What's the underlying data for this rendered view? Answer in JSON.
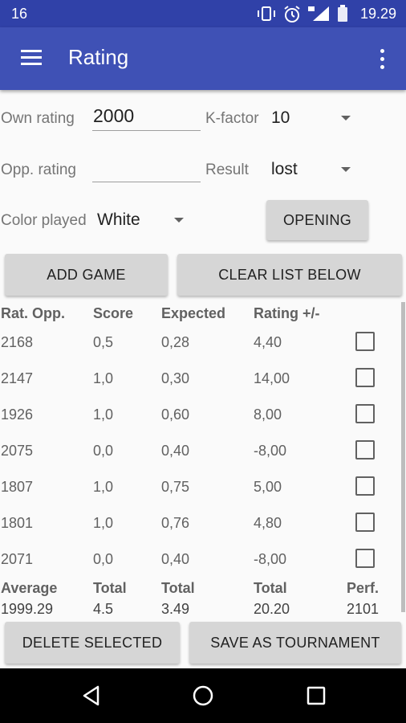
{
  "status_bar": {
    "left_time": "16",
    "time": "19.29"
  },
  "app_bar": {
    "title": "Rating"
  },
  "form": {
    "own_rating_label": "Own rating",
    "own_rating_value": "2000",
    "kfactor_label": "K-factor",
    "kfactor_value": "10",
    "opp_rating_label": "Opp. rating",
    "opp_rating_value": "",
    "result_label": "Result",
    "result_value": "lost",
    "color_label": "Color played",
    "color_value": "White",
    "opening_button": "OPENING"
  },
  "actions": {
    "add_game": "ADD GAME",
    "clear_list": "CLEAR LIST BELOW"
  },
  "table": {
    "headers": [
      "Rat. Opp.",
      "Score",
      "Expected",
      "Rating +/-"
    ],
    "rows": [
      [
        "2168",
        "0,5",
        "0,28",
        "4,40"
      ],
      [
        "2147",
        "1,0",
        "0,30",
        "14,00"
      ],
      [
        "1926",
        "1,0",
        "0,60",
        "8,00"
      ],
      [
        "2075",
        "0,0",
        "0,40",
        "-8,00"
      ],
      [
        "1807",
        "1,0",
        "0,75",
        "5,00"
      ],
      [
        "1801",
        "1,0",
        "0,76",
        "4,80"
      ],
      [
        "2071",
        "0,0",
        "0,40",
        "-8,00"
      ]
    ],
    "footer_labels": [
      "Average",
      "Total",
      "Total",
      "Total",
      "Perf."
    ],
    "footer_values": [
      "1999.29",
      "4.5",
      "3.49",
      "20.20",
      "2101"
    ]
  },
  "bottom": {
    "delete_selected": "DELETE SELECTED",
    "save_tournament": "SAVE AS TOURNAMENT"
  }
}
